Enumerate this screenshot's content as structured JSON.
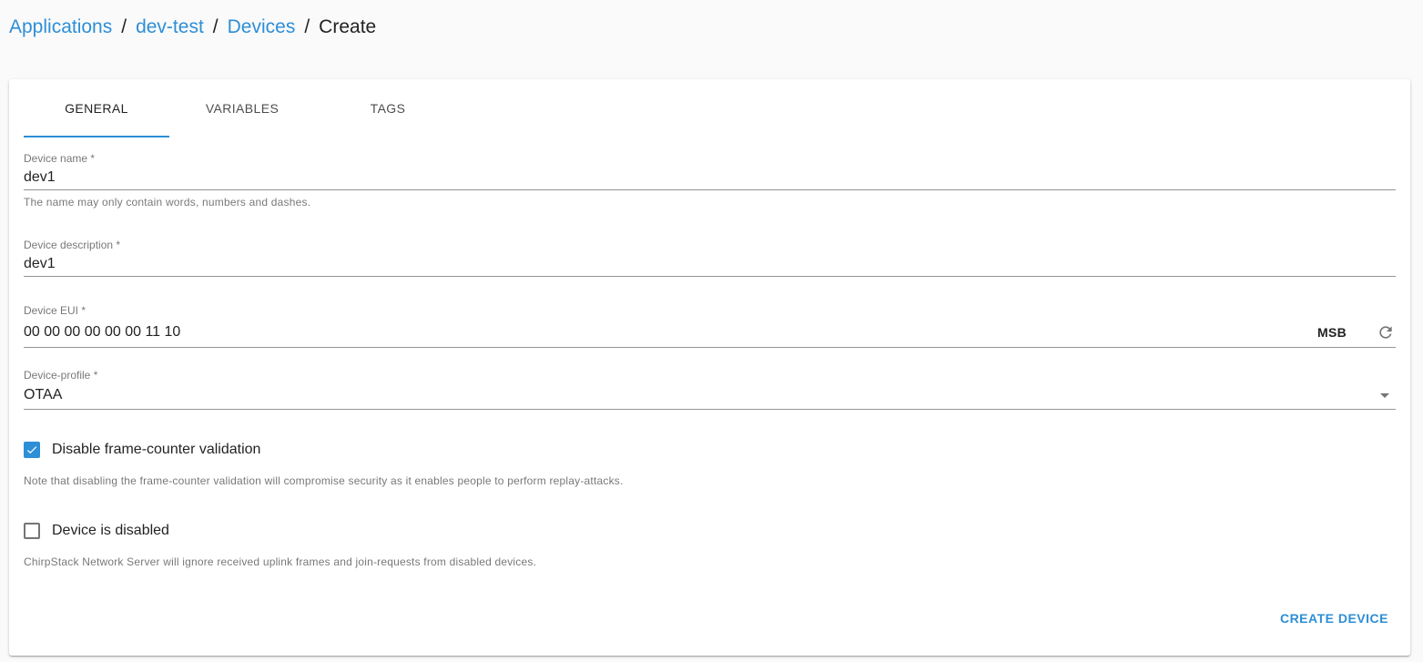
{
  "breadcrumb": {
    "applications": "Applications",
    "application": "dev-test",
    "devices": "Devices",
    "current": "Create",
    "separator": "/"
  },
  "tabs": [
    {
      "label": "GENERAL",
      "active": true
    },
    {
      "label": "VARIABLES",
      "active": false
    },
    {
      "label": "TAGS",
      "active": false
    }
  ],
  "form": {
    "device_name": {
      "label": "Device name *",
      "value": "dev1",
      "helper": "The name may only contain words, numbers and dashes."
    },
    "device_description": {
      "label": "Device description *",
      "value": "dev1"
    },
    "device_eui": {
      "label": "Device EUI *",
      "value": "00 00 00 00 00 00 11 10",
      "byte_order": "MSB"
    },
    "device_profile": {
      "label": "Device-profile *",
      "value": "OTAA"
    },
    "disable_fcnt": {
      "label": "Disable frame-counter validation",
      "checked": true,
      "note": "Note that disabling the frame-counter validation will compromise security as it enables people to perform replay-attacks."
    },
    "device_disabled": {
      "label": "Device is disabled",
      "checked": false,
      "note": "ChirpStack Network Server will ignore received uplink frames and join-requests from disabled devices."
    }
  },
  "actions": {
    "create_label": "CREATE DEVICE"
  },
  "colors": {
    "accent": "#2e8ed6",
    "background": "#fafafa"
  }
}
